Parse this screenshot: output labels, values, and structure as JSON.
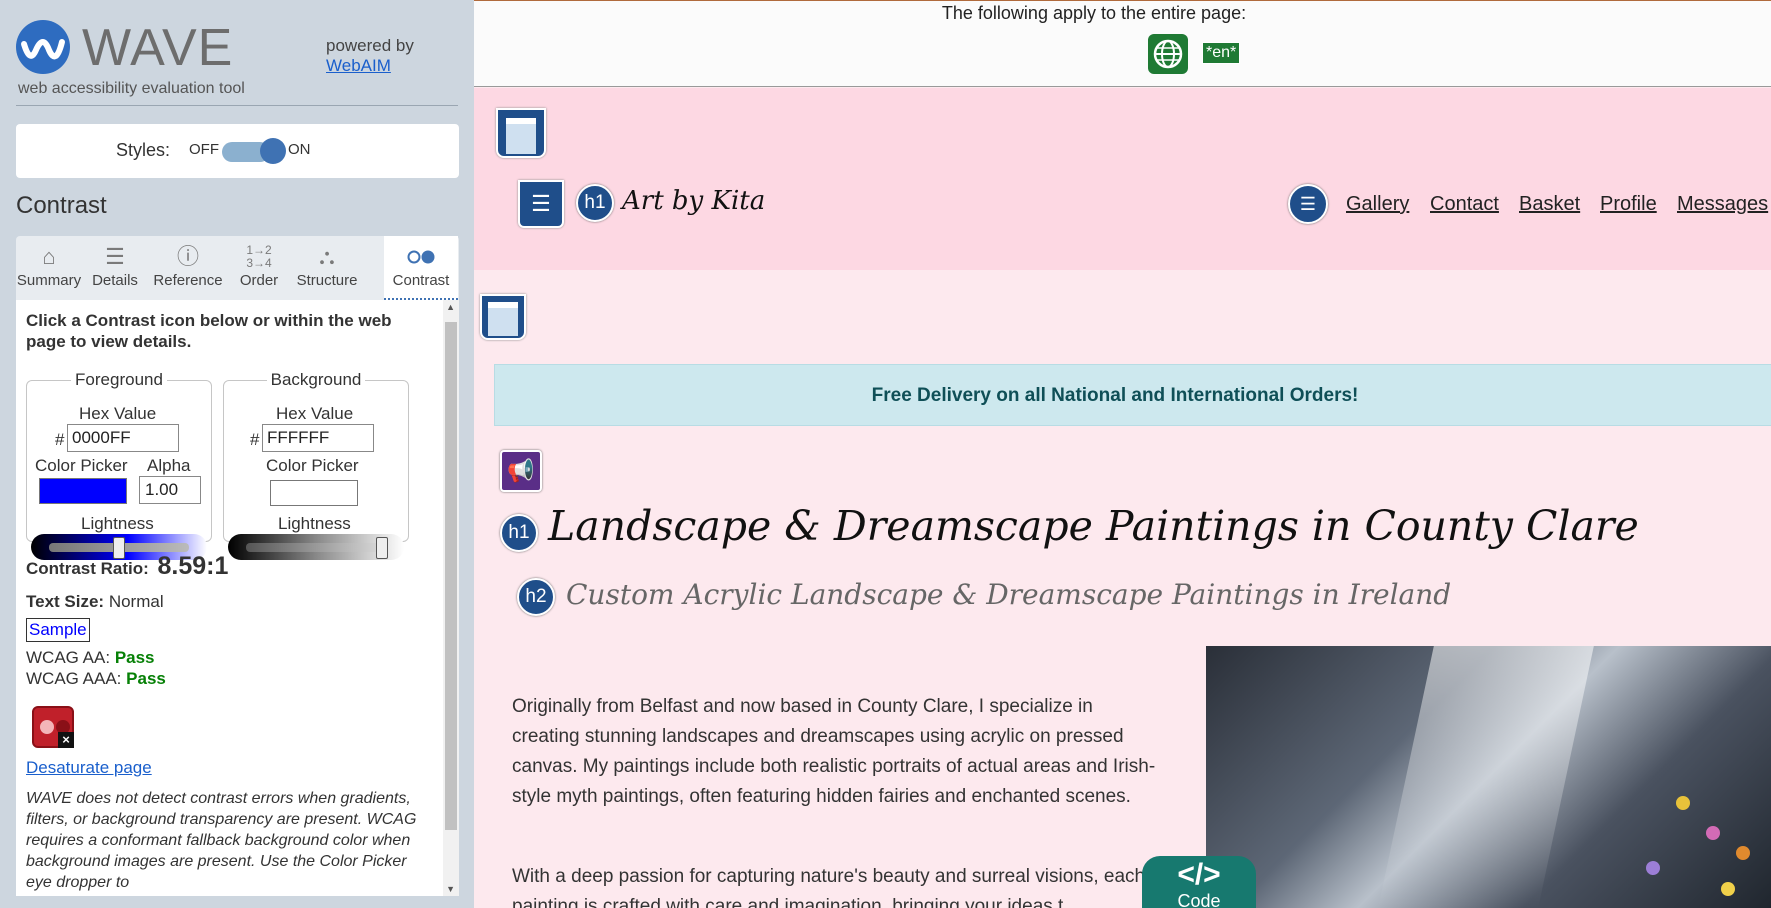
{
  "sidebar": {
    "brand": "WAVE",
    "tagline": "web accessibility evaluation tool",
    "powered_by": "powered by",
    "powered_link": "WebAIM",
    "styles": {
      "label": "Styles:",
      "off": "OFF",
      "on": "ON",
      "state": "on"
    },
    "panel_title": "Contrast",
    "tabs": [
      {
        "label": "Summary",
        "icon": "home-icon"
      },
      {
        "label": "Details",
        "icon": "list-icon"
      },
      {
        "label": "Reference",
        "icon": "info-icon"
      },
      {
        "label": "Order",
        "icon": "order-icon"
      },
      {
        "label": "Structure",
        "icon": "structure-icon"
      },
      {
        "label": "Contrast",
        "icon": "contrast-icon",
        "active": true
      }
    ]
  },
  "contrast": {
    "intro": "Click a Contrast icon below or within the web page to view details.",
    "foreground": {
      "legend": "Foreground",
      "hex_label": "Hex Value",
      "hash": "#",
      "hex": "0000FF",
      "picker_label": "Color Picker",
      "alpha_label": "Alpha",
      "alpha": "1.00",
      "lightness_label": "Lightness",
      "color": "#0000ff"
    },
    "background": {
      "legend": "Background",
      "hex_label": "Hex Value",
      "hash": "#",
      "hex": "FFFFFF",
      "picker_label": "Color Picker",
      "lightness_label": "Lightness",
      "color": "#ffffff"
    },
    "ratio_label": "Contrast Ratio:",
    "ratio": "8.59:1",
    "text_size_label": "Text Size:",
    "text_size": "Normal",
    "sample": "Sample",
    "wcag_aa_label": "WCAG AA:",
    "wcag_aa": "Pass",
    "wcag_aaa_label": "WCAG AAA:",
    "wcag_aaa": "Pass",
    "desaturate": "Desaturate page",
    "note": "WAVE does not detect contrast errors when gradients, filters, or background transparency are present. WCAG requires a conformant fallback background color when background images are present. Use the Color Picker eye dropper to"
  },
  "page": {
    "notice": "The following apply to the entire page:",
    "lang": "*en*",
    "brand": "Art by Kita",
    "nav": [
      "Gallery",
      "Contact",
      "Basket",
      "Profile",
      "Messages"
    ],
    "promo": "Free Delivery on all National and International Orders!",
    "h1": "Landscape & Dreamscape Paintings in County Clare",
    "h2": "Custom Acrylic Landscape & Dreamscape Paintings in Ireland",
    "para1": "Originally from Belfast and now based in County Clare, I specialize in creating stunning landscapes and dreamscapes using acrylic on pressed canvas. My paintings include both realistic portraits of actual areas and Irish-style myth paintings, often featuring hidden fairies and enchanted scenes.",
    "para2": "With a deep passion for capturing nature's beauty and surreal visions, each painting is crafted with care and imagination, bringing your ideas t",
    "code_tab": "Code",
    "code_tab_icon": "</>",
    "h1_badge": "h1",
    "h2_badge": "h2"
  }
}
